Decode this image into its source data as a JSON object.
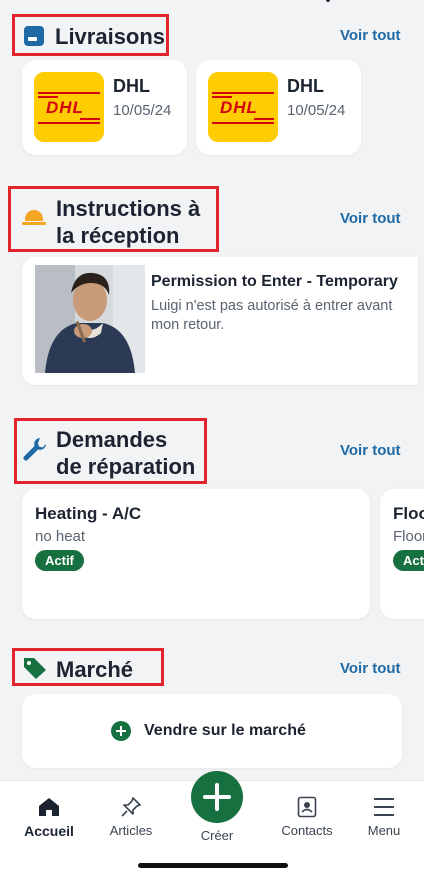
{
  "livraisons": {
    "title": "Livraisons",
    "see_all": "Voir tout",
    "items": [
      {
        "carrier": "DHL",
        "date": "10/05/24",
        "logo_text": "DHL"
      },
      {
        "carrier": "DHL",
        "date": "10/05/24",
        "logo_text": "DHL"
      }
    ]
  },
  "instructions": {
    "title_line1": "Instructions à",
    "title_line2": "la réception",
    "see_all": "Voir tout",
    "item": {
      "title": "Permission to Enter - Temporary",
      "desc_line1": "Luigi n'est pas autorisé à entrer avant",
      "desc_line2": "mon retour."
    }
  },
  "repairs": {
    "title_line1": "Demandes",
    "title_line2": "de réparation",
    "see_all": "Voir tout",
    "items": [
      {
        "title": "Heating - A/C",
        "desc": "no heat",
        "status": "Actif"
      },
      {
        "title": "Floo",
        "desc": "Floor",
        "status": "Acti"
      }
    ]
  },
  "market": {
    "title": "Marché",
    "see_all": "Voir tout",
    "sell_label": "Vendre sur le marché"
  },
  "nav": {
    "home": "Accueil",
    "articles": "Articles",
    "create": "Créer",
    "contacts": "Contacts",
    "menu": "Menu"
  },
  "colors": {
    "accent": "#1f6aa5",
    "green": "#17703f",
    "highlight": "#e3232b",
    "dhl_yellow": "#ffcc00",
    "dhl_red": "#d40511"
  }
}
